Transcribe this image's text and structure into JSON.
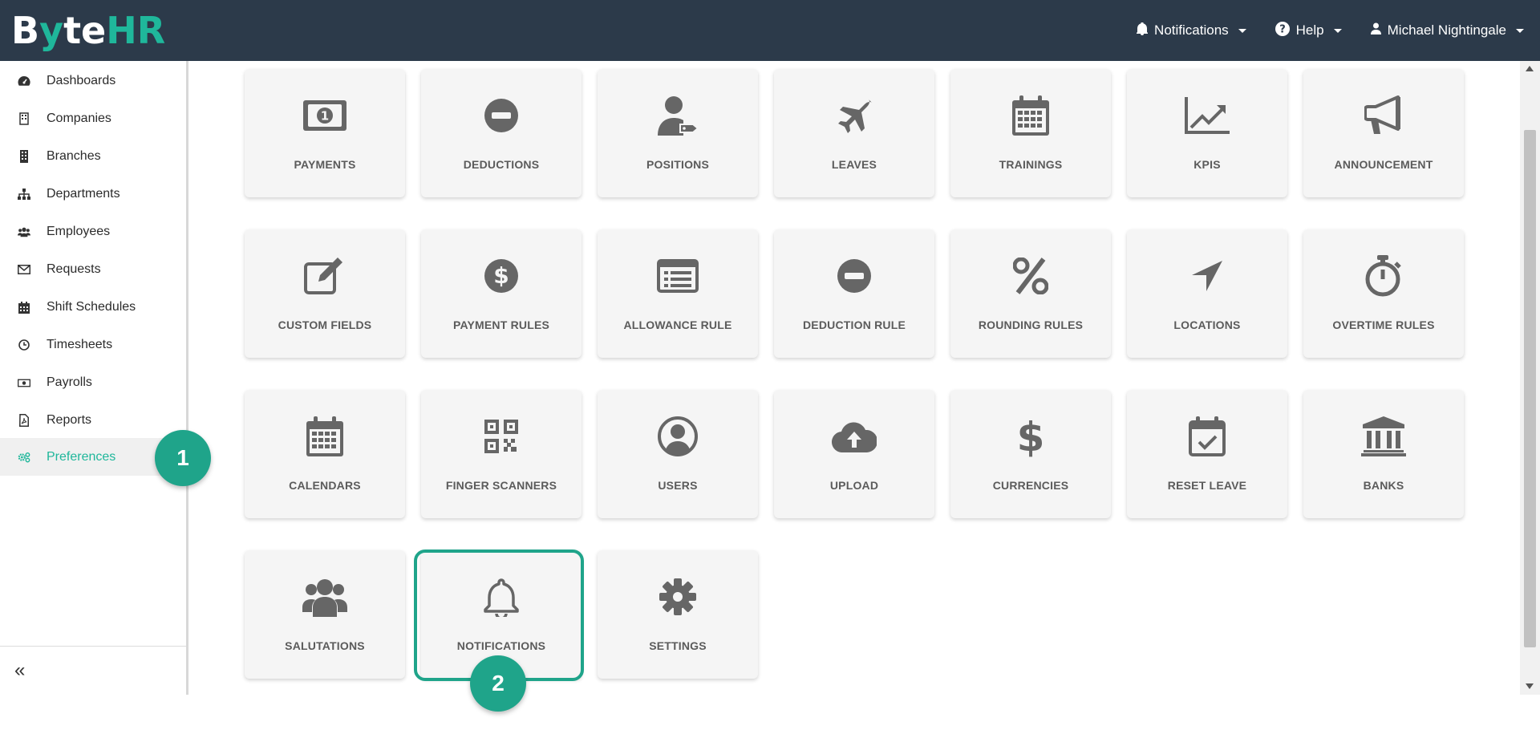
{
  "brand": {
    "b": "B",
    "y": "y",
    "te": "te",
    "hr": "HR",
    "accent": "#1fb79b",
    "navbar_bg": "#2c3a4a"
  },
  "topnav": {
    "notifications": "Notifications",
    "help": "Help",
    "user": "Michael Nightingale"
  },
  "sidebar": {
    "items": [
      {
        "label": "Dashboards",
        "icon": "dashboard-icon"
      },
      {
        "label": "Companies",
        "icon": "building-icon"
      },
      {
        "label": "Branches",
        "icon": "building-solid-icon"
      },
      {
        "label": "Departments",
        "icon": "sitemap-icon"
      },
      {
        "label": "Employees",
        "icon": "users-icon"
      },
      {
        "label": "Requests",
        "icon": "envelope-icon"
      },
      {
        "label": "Shift Schedules",
        "icon": "calendar-icon"
      },
      {
        "label": "Timesheets",
        "icon": "clock-icon"
      },
      {
        "label": "Payrolls",
        "icon": "money-bill-icon"
      },
      {
        "label": "Reports",
        "icon": "pdf-file-icon"
      },
      {
        "label": "Preferences",
        "icon": "cogs-icon"
      }
    ],
    "active": "Preferences",
    "collapse_glyph": "«"
  },
  "cards": {
    "row1": [
      "PAYMENTS",
      "DEDUCTIONS",
      "POSITIONS",
      "LEAVES",
      "TRAININGS",
      "KPIS",
      "ANNOUNCEMENT"
    ],
    "row2": [
      "CUSTOM FIELDS",
      "PAYMENT RULES",
      "ALLOWANCE RULE",
      "DEDUCTION RULE",
      "ROUNDING RULES",
      "LOCATIONS",
      "OVERTIME RULES"
    ],
    "row3": [
      "CALENDARS",
      "FINGER SCANNERS",
      "USERS",
      "UPLOAD",
      "CURRENCIES",
      "RESET LEAVE",
      "BANKS"
    ],
    "row4": [
      "SALUTATIONS",
      "NOTIFICATIONS",
      "SETTINGS"
    ]
  },
  "annotations": {
    "step1": "1",
    "step2": "2",
    "color": "#1fa48a"
  }
}
